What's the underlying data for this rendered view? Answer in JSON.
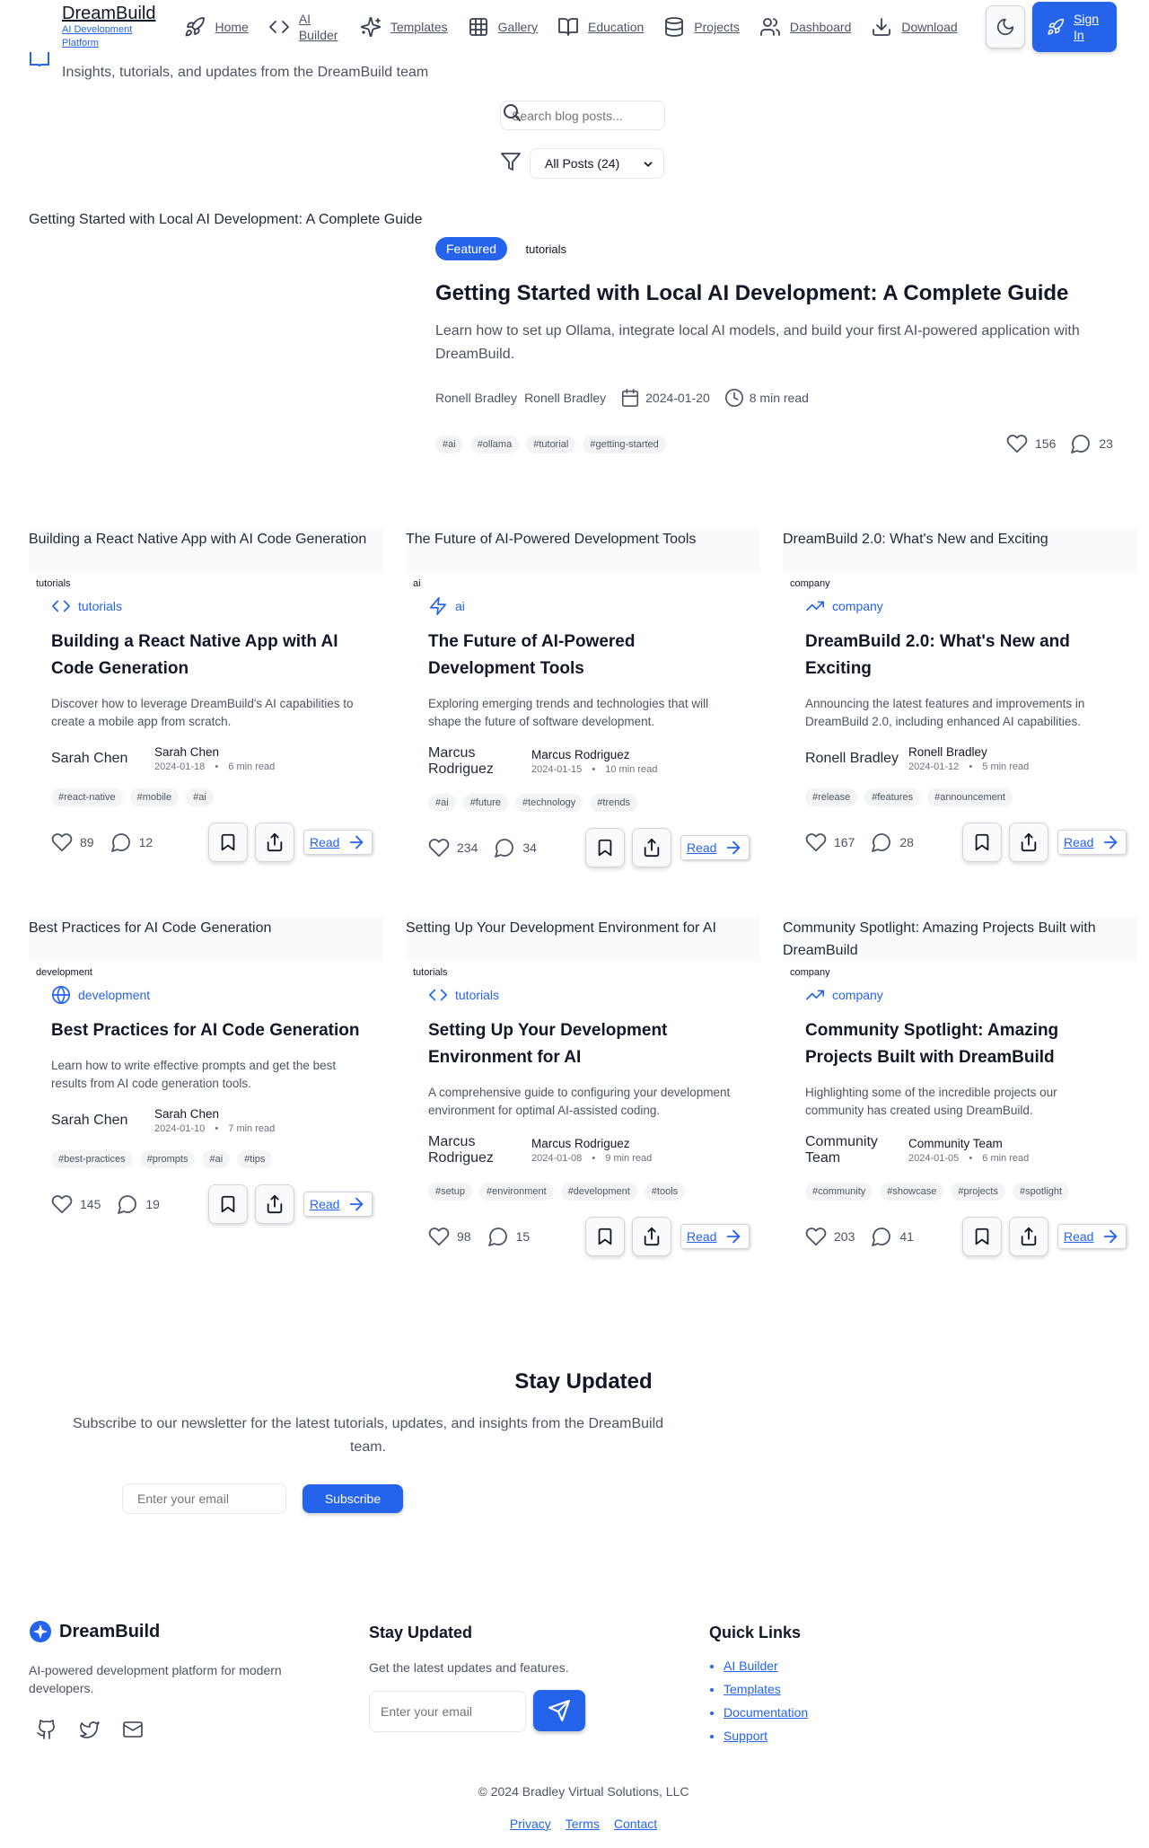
{
  "brand": {
    "name": "DreamBuild",
    "tagline": "AI Development Platform",
    "accent": "#2563eb"
  },
  "nav": {
    "items": [
      {
        "label": "Home",
        "icon": "rocket-icon"
      },
      {
        "label": "AI Builder",
        "icon": "code-icon"
      },
      {
        "label": "Templates",
        "icon": "sparkles-icon"
      },
      {
        "label": "Gallery",
        "icon": "grid-icon"
      },
      {
        "label": "Education",
        "icon": "book-open-icon"
      },
      {
        "label": "Projects",
        "icon": "database-icon"
      },
      {
        "label": "Dashboard",
        "icon": "users-icon"
      },
      {
        "label": "Download",
        "icon": "download-icon"
      }
    ],
    "sign_in": "Sign In"
  },
  "hero": {
    "subtitle": "Insights, tutorials, and updates from the DreamBuild team"
  },
  "search": {
    "placeholder": "Search blog posts..."
  },
  "filter": {
    "selected": "All Posts (24)"
  },
  "featured": {
    "image_alt": "Getting Started with Local AI Development: A Complete Guide",
    "badge": "Featured",
    "category": "tutorials",
    "title": "Getting Started with Local AI Development: A Complete Guide",
    "excerpt": "Learn how to set up Ollama, integrate local AI models, and build your first AI-powered application with DreamBuild.",
    "avatar_alt": "Ronell Bradley",
    "author": "Ronell Bradley",
    "date": "2024-01-20",
    "read_time": "8 min read",
    "tags": [
      "#ai",
      "#ollama",
      "#tutorial",
      "#getting-started"
    ],
    "likes": "156",
    "comments": "23"
  },
  "posts": [
    {
      "image_alt": "Building a React Native App with AI Code Generation",
      "cat_pill": "tutorials",
      "category": "tutorials",
      "title": "Building a React Native App with AI Code Generation",
      "excerpt": "Discover how to leverage DreamBuild's AI capabilities to create a mobile app from scratch.",
      "avatar_alt": "Sarah Chen",
      "author": "Sarah Chen",
      "date": "2024-01-18",
      "read_time": "6 min read",
      "tags": [
        "#react-native",
        "#mobile",
        "#ai"
      ],
      "likes": "89",
      "comments": "12",
      "read": "Read"
    },
    {
      "image_alt": "The Future of AI-Powered Development Tools",
      "cat_pill": "ai",
      "category": "ai",
      "title": "The Future of AI-Powered Development Tools",
      "excerpt": "Exploring emerging trends and technologies that will shape the future of software development.",
      "avatar_alt": "Marcus Rodriguez",
      "author": "Marcus Rodriguez",
      "date": "2024-01-15",
      "read_time": "10 min read",
      "tags": [
        "#ai",
        "#future",
        "#technology",
        "#trends"
      ],
      "likes": "234",
      "comments": "34",
      "read": "Read"
    },
    {
      "image_alt": "DreamBuild 2.0: What's New and Exciting",
      "cat_pill": "company",
      "category": "company",
      "title": "DreamBuild 2.0: What's New and Exciting",
      "excerpt": "Announcing the latest features and improvements in DreamBuild 2.0, including enhanced AI capabilities.",
      "avatar_alt": "Ronell Bradley",
      "author": "Ronell Bradley",
      "date": "2024-01-12",
      "read_time": "5 min read",
      "tags": [
        "#release",
        "#features",
        "#announcement"
      ],
      "likes": "167",
      "comments": "28",
      "read": "Read"
    },
    {
      "image_alt": "Best Practices for AI Code Generation",
      "cat_pill": "development",
      "category": "development",
      "title": "Best Practices for AI Code Generation",
      "excerpt": "Learn how to write effective prompts and get the best results from AI code generation tools.",
      "avatar_alt": "Sarah Chen",
      "author": "Sarah Chen",
      "date": "2024-01-10",
      "read_time": "7 min read",
      "tags": [
        "#best-practices",
        "#prompts",
        "#ai",
        "#tips"
      ],
      "likes": "145",
      "comments": "19",
      "read": "Read"
    },
    {
      "image_alt": "Setting Up Your Development Environment for AI",
      "cat_pill": "tutorials",
      "category": "tutorials",
      "title": "Setting Up Your Development Environment for AI",
      "excerpt": "A comprehensive guide to configuring your development environment for optimal AI-assisted coding.",
      "avatar_alt": "Marcus Rodriguez",
      "author": "Marcus Rodriguez",
      "date": "2024-01-08",
      "read_time": "9 min read",
      "tags": [
        "#setup",
        "#environment",
        "#development",
        "#tools"
      ],
      "likes": "98",
      "comments": "15",
      "read": "Read"
    },
    {
      "image_alt": "Community Spotlight: Amazing Projects Built with DreamBuild",
      "cat_pill": "company",
      "category": "company",
      "title": "Community Spotlight: Amazing Projects Built with DreamBuild",
      "excerpt": "Highlighting some of the incredible projects our community has created using DreamBuild.",
      "avatar_alt": "Community Team",
      "author": "Community Team",
      "date": "2024-01-05",
      "read_time": "6 min read",
      "tags": [
        "#community",
        "#showcase",
        "#projects",
        "#spotlight"
      ],
      "likes": "203",
      "comments": "41",
      "read": "Read"
    }
  ],
  "newsletter": {
    "title": "Stay Updated",
    "subtitle": "Subscribe to our newsletter for the latest tutorials, updates, and insights from the DreamBuild team.",
    "placeholder": "Enter your email",
    "button": "Subscribe"
  },
  "footer": {
    "brand": "DreamBuild",
    "description": "AI-powered development platform for modern developers.",
    "social_icons": [
      "github-icon",
      "twitter-icon",
      "mail-icon"
    ],
    "newsletter_title": "Stay Updated",
    "newsletter_text": "Get the latest updates and features.",
    "newsletter_placeholder": "Enter your email",
    "quick_links_title": "Quick Links",
    "quick_links": [
      "AI Builder",
      "Templates",
      "Documentation",
      "Support"
    ],
    "copyright": "© 2024 Bradley Virtual Solutions, LLC",
    "legal": [
      "Privacy",
      "Terms",
      "Contact"
    ]
  }
}
